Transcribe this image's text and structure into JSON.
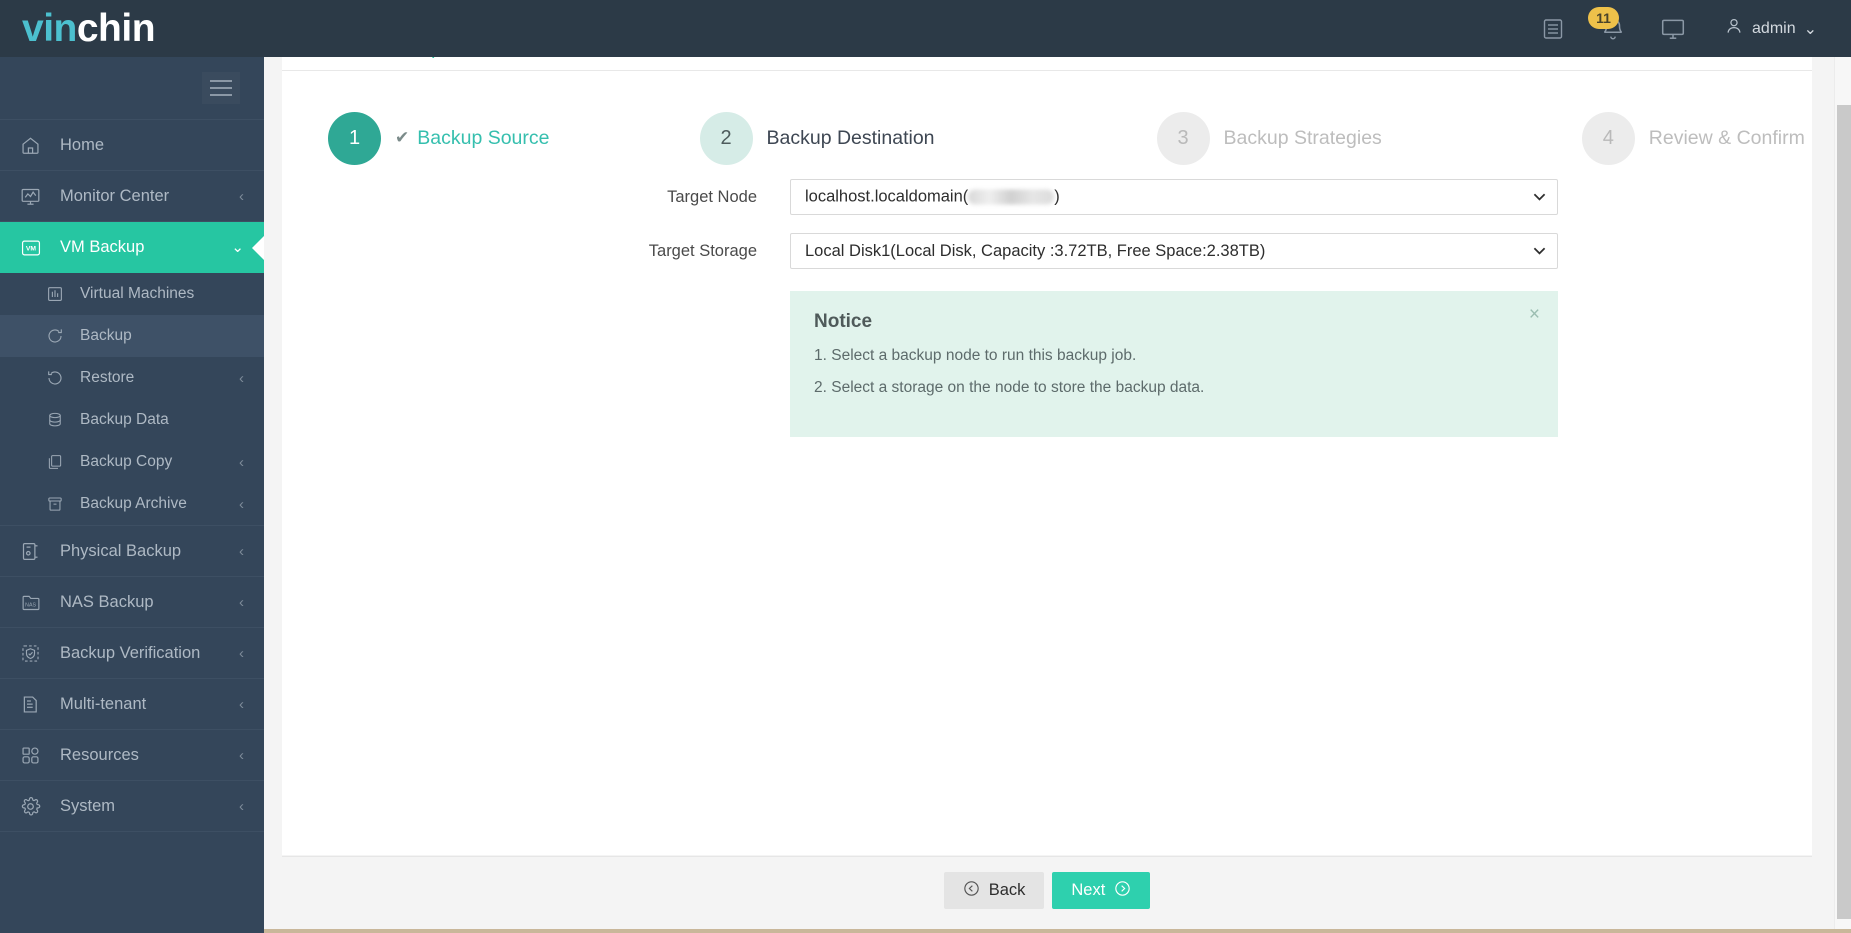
{
  "header": {
    "logo_vin": "vin",
    "logo_chin": "chin",
    "icons": [
      {
        "name": "list-icon",
        "glyph": "list"
      },
      {
        "name": "bell-icon",
        "glyph": "bell",
        "badge": "11"
      },
      {
        "name": "monitor-icon",
        "glyph": "monitor"
      }
    ],
    "user": {
      "label": "admin",
      "icon": "user-icon",
      "caret": "⌄"
    }
  },
  "sidebar": {
    "toggle_name": "hamburger-toggle",
    "items": [
      {
        "label": "Home",
        "icon": "home-icon",
        "caret": "",
        "active": false
      },
      {
        "label": "Monitor Center",
        "icon": "monitor-chart-icon",
        "caret": "‹",
        "active": false
      },
      {
        "label": "VM Backup",
        "icon": "vm-icon",
        "caret": "⌄",
        "active": true
      },
      {
        "label": "Physical Backup",
        "icon": "server-icon",
        "caret": "‹",
        "active": false
      },
      {
        "label": "NAS Backup",
        "icon": "nas-icon",
        "caret": "‹",
        "active": false
      },
      {
        "label": "Backup Verification",
        "icon": "shield-check-icon",
        "caret": "‹",
        "active": false
      },
      {
        "label": "Multi-tenant",
        "icon": "building-icon",
        "caret": "‹",
        "active": false
      },
      {
        "label": "Resources",
        "icon": "grid-icon",
        "caret": "‹",
        "active": false
      },
      {
        "label": "System",
        "icon": "gear-icon",
        "caret": "‹",
        "active": false
      }
    ],
    "subitems": [
      {
        "label": "Virtual Machines",
        "icon": "chart-bar-icon",
        "caret": "",
        "selected": false
      },
      {
        "label": "Backup",
        "icon": "refresh-icon",
        "caret": "",
        "selected": true
      },
      {
        "label": "Restore",
        "icon": "undo-icon",
        "caret": "‹",
        "selected": false
      },
      {
        "label": "Backup Data",
        "icon": "database-icon",
        "caret": "",
        "selected": false
      },
      {
        "label": "Backup Copy",
        "icon": "copy-icon",
        "caret": "‹",
        "selected": false
      },
      {
        "label": "Backup Archive",
        "icon": "archive-icon",
        "caret": "‹",
        "selected": false
      }
    ]
  },
  "page": {
    "title": "New Backup Job",
    "title_icon": "refresh-circle-icon"
  },
  "wizard": {
    "steps": [
      {
        "number": "1",
        "label": "Backup Source",
        "state": "done",
        "check": "✔"
      },
      {
        "number": "2",
        "label": "Backup Destination",
        "state": "current",
        "check": ""
      },
      {
        "number": "3",
        "label": "Backup Strategies",
        "state": "todo",
        "check": ""
      },
      {
        "number": "4",
        "label": "Review & Confirm",
        "state": "todo",
        "check": ""
      }
    ]
  },
  "form": {
    "target_node": {
      "label": "Target Node",
      "value_prefix": "localhost.localdomain(",
      "value_suffix": ")",
      "value_redacted": true,
      "caret": "⌄"
    },
    "target_storage": {
      "label": "Target Storage",
      "value": "Local Disk1(Local Disk, Capacity :3.72TB, Free Space:2.38TB)",
      "caret": "⌄"
    }
  },
  "notice": {
    "title": "Notice",
    "close_label": "×",
    "lines": [
      "1. Select a backup node to run this backup job.",
      "2. Select a storage on the node to store the backup data."
    ]
  },
  "footer": {
    "back_label": "Back",
    "back_icon": "arrow-left-circle-icon",
    "next_label": "Next",
    "next_icon": "arrow-right-circle-icon"
  },
  "colors": {
    "brand_teal": "#26c6a2",
    "sidebar_bg": "#34465a",
    "topbar_bg": "#2c3a47",
    "badge_yellow": "#eec14a",
    "notice_bg": "#e1f3ec",
    "next_btn": "#2ed0ae"
  }
}
